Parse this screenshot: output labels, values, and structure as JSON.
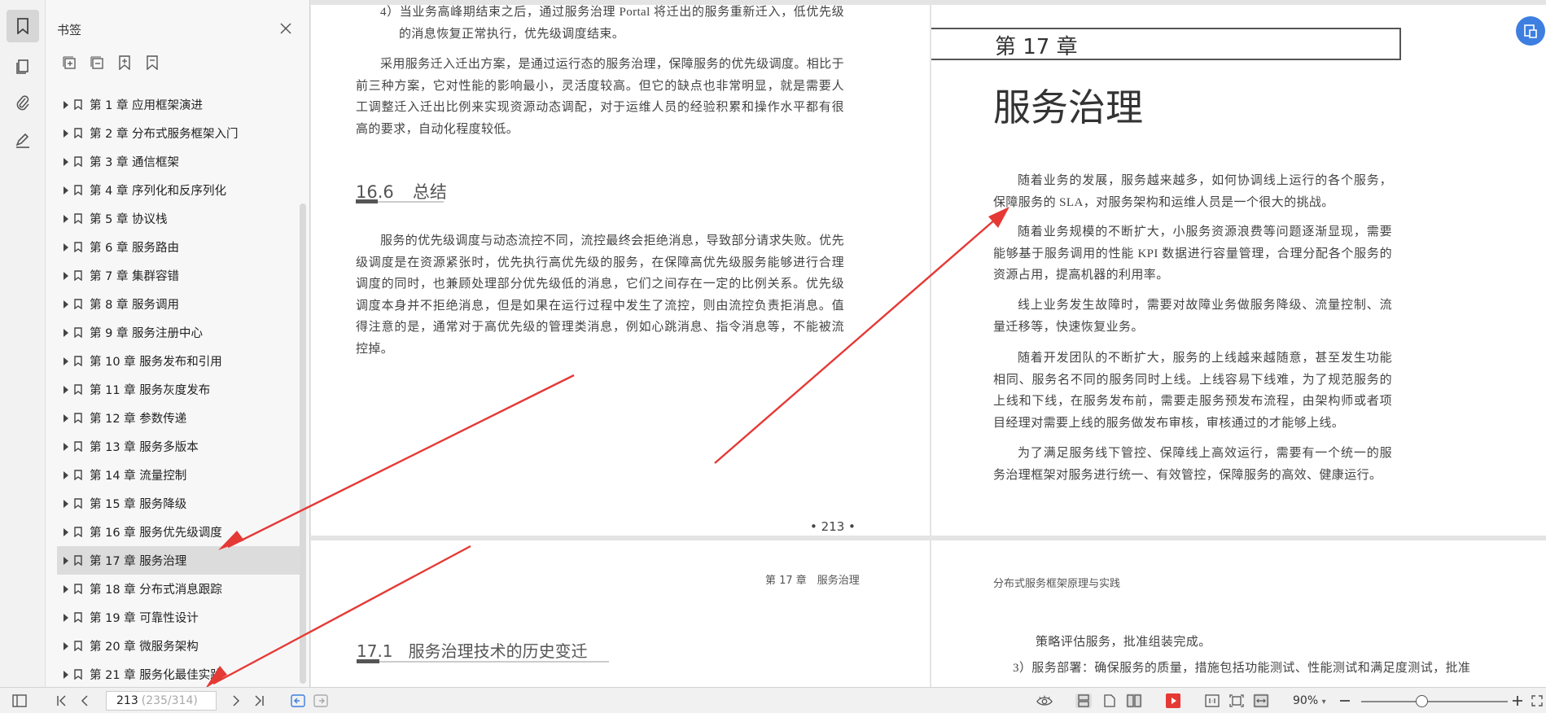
{
  "panel": {
    "title": "书签",
    "items": [
      "第 1 章  应用框架演进",
      "第 2 章  分布式服务框架入门",
      "第 3 章  通信框架",
      "第 4 章  序列化和反序列化",
      "第 5 章  协议栈",
      "第 6 章  服务路由",
      "第 7 章  集群容错",
      "第 8 章  服务调用",
      "第 9 章  服务注册中心",
      "第 10 章  服务发布和引用",
      "第 11 章  服务灰度发布",
      "第 12 章  参数传递",
      "第 13 章  服务多版本",
      "第 14 章  流量控制",
      "第 15 章  服务降级",
      "第 16 章  服务优先级调度",
      "第 17 章  服务治理",
      "第 18 章  分布式消息跟踪",
      "第 19 章  可靠性设计",
      "第 20 章  微服务架构",
      "第 21 章  服务化最佳实践"
    ],
    "selected_index": 16
  },
  "page_left": {
    "p4": "4）当业务高峰期结束之后，通过服务治理 Portal 将迁出的服务重新迁入，低优先级的消息恢复正常执行，优先级调度结束。",
    "para1": "采用服务迁入迁出方案，是通过运行态的服务治理，保障服务的优先级调度。相比于前三种方案，它对性能的影响最小，灵活度较高。但它的缺点也非常明显，就是需要人工调整迁入迁出比例来实现资源动态调配，对于运维人员的经验积累和操作水平都有很高的要求，自动化程度较低。",
    "section_num": "16.6",
    "section_title": "总结",
    "para2": "服务的优先级调度与动态流控不同，流控最终会拒绝消息，导致部分请求失败。优先级调度是在资源紧张时，优先执行高优先级的服务，在保障高优先级服务能够进行合理调度的同时，也兼顾处理部分优先级低的消息，它们之间存在一定的比例关系。优先级调度本身并不拒绝消息，但是如果在运行过程中发生了流控，则由流控负责拒消息。值得注意的是，通常对于高优先级的管理类消息，例如心跳消息、指令消息等，不能被流控掉。",
    "page_number": "• 213 •"
  },
  "page_right": {
    "chapter_label": "第 17 章",
    "chapter_title": "服务治理",
    "paras": [
      "随着业务的发展，服务越来越多，如何协调线上运行的各个服务，保障服务的 SLA，对服务架构和运维人员是一个很大的挑战。",
      "随着业务规模的不断扩大，小服务资源浪费等问题逐渐显现，需要能够基于服务调用的性能 KPI 数据进行容量管理，合理分配各个服务的资源占用，提高机器的利用率。",
      "线上业务发生故障时，需要对故障业务做服务降级、流量控制、流量迁移等，快速恢复业务。",
      "随着开发团队的不断扩大，服务的上线越来越随意，甚至发生功能相同、服务名不同的服务同时上线。上线容易下线难，为了规范服务的上线和下线，在服务发布前，需要走服务预发布流程，由架构师或者项目经理对需要上线的服务做发布审核，审核通过的才能够上线。",
      "为了满足服务线下管控、保障线上高效运行，需要有一个统一的服务治理框架对服务进行统一、有效管控，保障服务的高效、健康运行。"
    ]
  },
  "page_bottom_left": {
    "header": "第 17 章　服务治理",
    "section_num": "17.1",
    "section_title": "服务治理技术的历史变迁"
  },
  "page_bottom_right": {
    "header": "分布式服务框架原理与实践",
    "line1": "策略评估服务，批准组装完成。",
    "line2": "3）服务部署：确保服务的质量，措施包括功能测试、性能测试和满足度测试，批准"
  },
  "status": {
    "current_page": "213",
    "total_pages": "(235/314)",
    "zoom": "90%"
  },
  "colors": {
    "arrow": "#e53935",
    "accent": "#3d7fe0",
    "selected_bg": "#dcdcdc"
  }
}
